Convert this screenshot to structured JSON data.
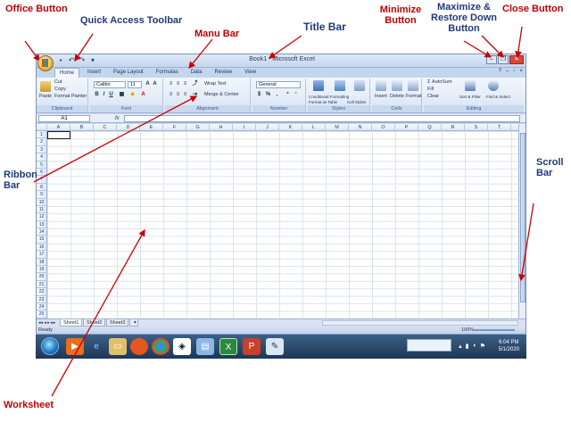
{
  "annotations": {
    "office_button": "Office Button",
    "quick_access": "Quick Access Toolbar",
    "menu_bar": "Manu Bar",
    "title_bar": "Title Bar",
    "minimize": "Minimize Button",
    "maximize": "Maximize & Restore Down Button",
    "close": "Close Button",
    "ribbon": "Ribbon Bar",
    "scroll": "Scroll Bar",
    "worksheet": "Worksheet"
  },
  "window": {
    "title": "Book1 - Microsoft Excel",
    "minimize_glyph": "–",
    "restore_glyph": "❐",
    "close_glyph": "✕"
  },
  "tabs": [
    "Home",
    "Insert",
    "Page Layout",
    "Formulas",
    "Data",
    "Review",
    "View"
  ],
  "ribbon": {
    "clipboard": {
      "label": "Clipboard",
      "paste": "Paste",
      "cut": "Cut",
      "copy": "Copy",
      "format_painter": "Format Painter"
    },
    "font": {
      "label": "Font",
      "name": "Calibri",
      "size": "11"
    },
    "alignment": {
      "label": "Alignment",
      "wrap": "Wrap Text",
      "merge": "Merge & Center"
    },
    "number": {
      "label": "Number",
      "format": "General",
      "currency": "$",
      "percent": "%"
    },
    "styles": {
      "label": "Styles",
      "conditional": "Conditional Formatting",
      "format_table": "Format as Table",
      "cell_styles": "Cell Styles"
    },
    "cells": {
      "label": "Cells",
      "insert": "Insert",
      "delete": "Delete",
      "format": "Format"
    },
    "editing": {
      "label": "Editing",
      "autosum": "AutoSum",
      "fill": "Fill",
      "clear": "Clear",
      "sort": "Sort & Filter",
      "find": "Find & Select"
    }
  },
  "formula_bar": {
    "name_box": "A1",
    "fx": "fx"
  },
  "columns": [
    "A",
    "B",
    "C",
    "D",
    "E",
    "F",
    "G",
    "H",
    "I",
    "J",
    "K",
    "L",
    "M",
    "N",
    "O",
    "P",
    "Q",
    "R",
    "S",
    "T",
    "U"
  ],
  "rows": [
    "1",
    "2",
    "3",
    "4",
    "5",
    "6",
    "7",
    "8",
    "9",
    "10",
    "11",
    "12",
    "13",
    "14",
    "15",
    "16",
    "17",
    "18",
    "19",
    "20",
    "21",
    "22",
    "23",
    "24",
    "25",
    "26"
  ],
  "sheets": [
    "Sheet1",
    "Sheet2",
    "Sheet3"
  ],
  "status": {
    "ready": "Ready",
    "zoom": "100%"
  },
  "clock": {
    "time": "6:04 PM",
    "date": "5/1/2020"
  },
  "colors": {
    "annotation_red": "#c00000",
    "annotation_blue": "#1f3a7a",
    "ribbon_bg": "#dde8f6",
    "taskbar": "#1d3756"
  }
}
